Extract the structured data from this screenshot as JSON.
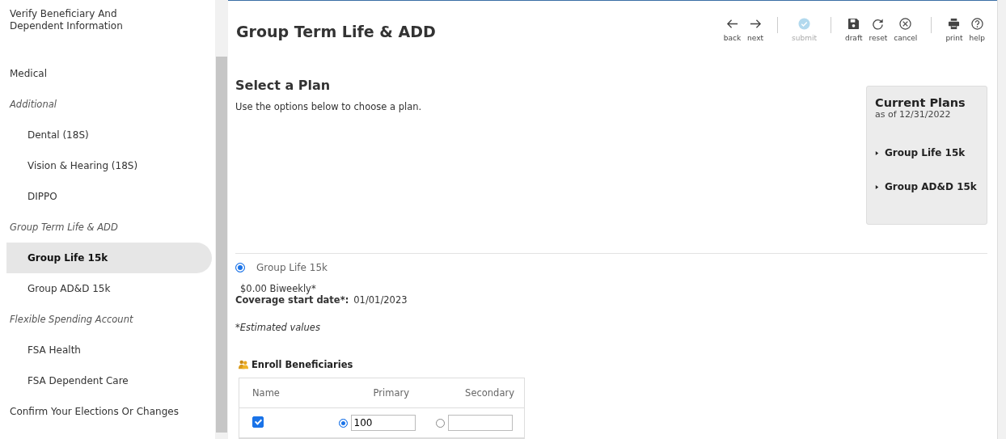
{
  "sidebar": {
    "items": [
      {
        "label": "Verify Beneficiary And Dependent Information",
        "kind": "link",
        "selected": false
      },
      {
        "label": "Medical",
        "kind": "link",
        "selected": false
      },
      {
        "label": "Additional",
        "kind": "section",
        "children": [
          {
            "label": "Dental (18S)",
            "kind": "link",
            "selected": false
          },
          {
            "label": "Vision & Hearing (18S)",
            "kind": "link",
            "selected": false
          },
          {
            "label": "DIPPO",
            "kind": "link",
            "selected": false
          }
        ]
      },
      {
        "label": "Group Term Life & ADD",
        "kind": "section",
        "children": [
          {
            "label": "Group Life 15k",
            "kind": "link",
            "selected": true
          },
          {
            "label": "Group AD&D 15k",
            "kind": "link",
            "selected": false
          }
        ]
      },
      {
        "label": "Flexible Spending Account",
        "kind": "section",
        "children": [
          {
            "label": "FSA Health",
            "kind": "link",
            "selected": false
          },
          {
            "label": "FSA Dependent Care",
            "kind": "link",
            "selected": false
          }
        ]
      },
      {
        "label": "Confirm Your Elections Or Changes",
        "kind": "link",
        "selected": false
      }
    ]
  },
  "page": {
    "title": "Group Term Life & ADD"
  },
  "toolbar": [
    [
      {
        "kind": "back",
        "label": "back",
        "disabled": false
      },
      {
        "kind": "next",
        "label": "next",
        "disabled": false
      }
    ],
    [
      {
        "kind": "submit",
        "label": "submit",
        "disabled": true
      }
    ],
    [
      {
        "kind": "draft",
        "label": "draft",
        "disabled": false
      },
      {
        "kind": "reset",
        "label": "reset",
        "disabled": false
      },
      {
        "kind": "cancel",
        "label": "cancel",
        "disabled": false
      }
    ],
    [
      {
        "kind": "print",
        "label": "print",
        "disabled": false
      },
      {
        "kind": "help",
        "label": "help",
        "disabled": false
      }
    ]
  ],
  "section": {
    "title": "Select a Plan",
    "subtitle": "Use the options below to choose a plan."
  },
  "current_plans": {
    "title": "Current Plans",
    "as_of": "as of 12/31/2022",
    "plans": [
      "Group Life 15k",
      "Group AD&D 15k"
    ]
  },
  "plan_option": {
    "label": "Group Life 15k",
    "selected": true,
    "cost": "$0.00 Biweekly*",
    "coverage_label": "Coverage start date*:",
    "coverage_value": "01/01/2023",
    "note": "*Estimated values"
  },
  "beneficiaries": {
    "title": "Enroll Beneficiaries",
    "columns": [
      "Name",
      "Primary",
      "Secondary"
    ],
    "rows": [
      {
        "checked": true,
        "primary_selected": true,
        "primary_value": "100",
        "secondary_selected": false
      }
    ]
  }
}
